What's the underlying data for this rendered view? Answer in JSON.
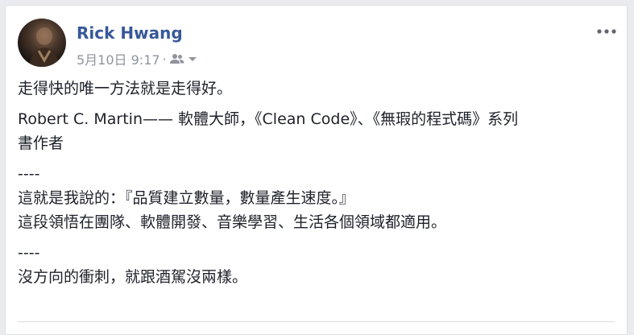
{
  "post": {
    "author": "Rick Hwang",
    "timestamp": "5月10日 9:17",
    "separator": "·",
    "audience_icon": "friends-icon",
    "audience_dropdown_icon": "chevron-down-icon",
    "more_icon": "more-options-icon",
    "lines": [
      "走得快的唯一方法就是走得好。",
      "Robert C. Martin—— 軟體大師，《Clean Code》、《無瑕的程式碼》系列",
      "書作者",
      "----",
      "這就是我說的：『品質建立數量，數量產生速度。』",
      "這段領悟在團隊、軟體開發、音樂學習、生活各個領域都適用。",
      "----",
      "沒方向的衝刺，就跟酒駕沒兩樣。"
    ]
  },
  "colors": {
    "author": "#385898",
    "meta": "#90949c",
    "text": "#1d2129",
    "background": "#e9ebee",
    "card": "#ffffff"
  }
}
